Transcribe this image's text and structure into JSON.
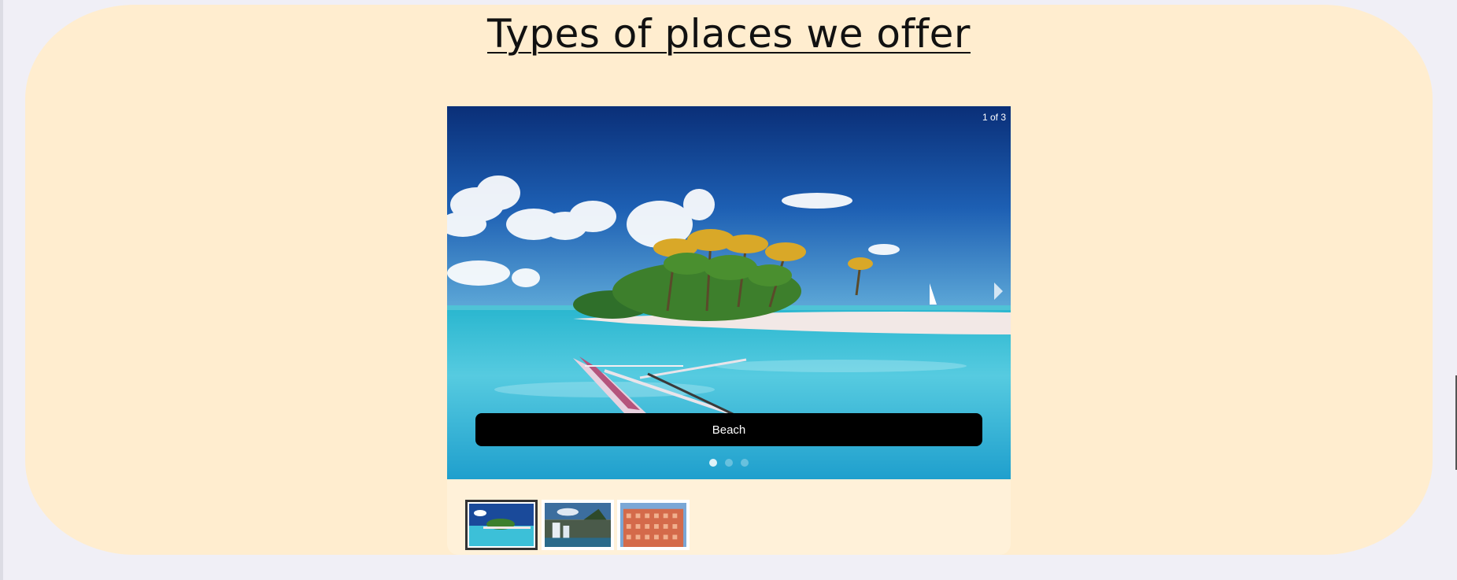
{
  "section": {
    "heading": "Types of places we offer"
  },
  "carousel": {
    "counter": "1 of 3",
    "active_index": 1,
    "total": 3,
    "slides": [
      {
        "caption": "Beach",
        "scene": "tropical-island-beach"
      },
      {
        "scene": "waterfall-landscape"
      },
      {
        "scene": "pink-palace-facade"
      }
    ],
    "next_icon": "chevron-right-icon"
  },
  "colors": {
    "page_background": "#f0eff6",
    "section_background": "#ffedcf",
    "caption_background": "#000000",
    "caption_text": "#ffffff"
  }
}
